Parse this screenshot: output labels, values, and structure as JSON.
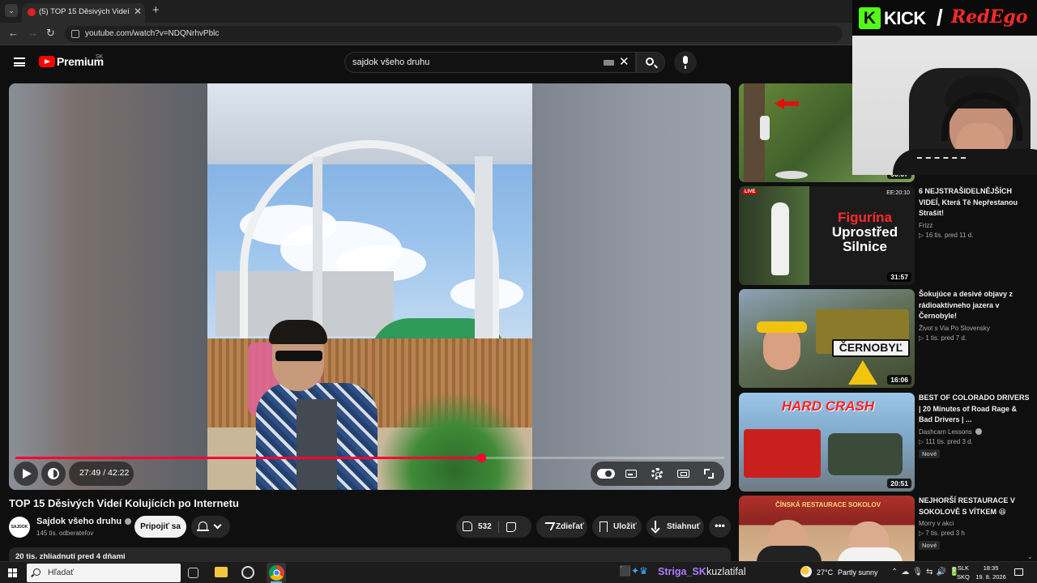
{
  "browser": {
    "tab_title": "(5) TOP 15 Děsivých Videí Koluj",
    "new_tab": "+",
    "url": "youtube.com/watch?v=NDQNrhvPblc"
  },
  "youtube": {
    "brand": "Premium",
    "country": "SK",
    "search_value": "sajdok všeho druhu"
  },
  "player": {
    "time": "27:49 / 42:22",
    "progress_fraction": 0.657
  },
  "video": {
    "title": "TOP 15 Děsivých Videí Kolujících po Internetu",
    "channel": "Sajdok všeho druhu",
    "channel_avatar_text": "SAJDOK",
    "subscribers": "145 tis. odberateľov",
    "join_label": "Pripojiť sa",
    "likes": "532",
    "share_label": "Zdieľať",
    "save_label": "Uložiť",
    "download_label": "Stiahnuť",
    "more_label": "•••",
    "description": "20 tis. zhliadnutí  pred 4 dňami"
  },
  "recommendations": [
    {
      "duration": "30:07",
      "title": "",
      "channel": "",
      "meta": "",
      "badge": ""
    },
    {
      "duration": "31:57",
      "thumb_text": "Figurína\nUprostřed\nSilnice",
      "live": "LIVE",
      "corner": "EE:20:10",
      "title": "6 NEJSTRAŠIDELNĚJŠÍCH VIDEÍ, Která Tě Nepřestanou Strašit!",
      "channel": "Frizz",
      "meta": "▷ 16 tis.  pred 11 d.",
      "badge": ""
    },
    {
      "duration": "16:06",
      "thumb_text": "ČERNOBYĽ",
      "title": "Šokujúce a desivé objavy z rádioaktívneho jazera v Černobyle!",
      "channel": "Život s Via Po Slovensky",
      "meta": "▷ 1 tis.  pred 7 d.",
      "badge": ""
    },
    {
      "duration": "20:51",
      "thumb_text": "HARD CRASH",
      "title": "BEST OF COLORADO DRIVERS |  20 Minutes of Road Rage & Bad Drivers | ...",
      "channel": "Dashcam Lessons",
      "meta": "▷ 111 tis.  pred 3 d.",
      "badge": "Nové"
    },
    {
      "duration": "",
      "thumb_text": "ČÍNSKÁ RESTAURACE SOKOLOV",
      "title": "NEJHORŠÍ RESTAURACE V SOKOLOVĚ S VÍTKEM 😆",
      "channel": "Morry v akci",
      "meta": "▷ 7 tis.  pred 3 h",
      "badge": "Nové"
    }
  ],
  "overlay": {
    "kick_letter": "K",
    "kick": "KICK",
    "slash": "/",
    "streamer": "RedEgo"
  },
  "taskbar": {
    "search_placeholder": "Hľadať",
    "chat_user": "Striga_SK",
    "chat_message": "kuzlatifal",
    "temperature": "27°C",
    "weather": "Partly sunny",
    "lang_1": "SLK",
    "lang_2": "SKQ",
    "time": "18:35",
    "date": "19. 8. 2026"
  },
  "colors": {
    "youtube_red": "#ff0000",
    "progress_red": "#ff0033",
    "kick_green": "#53fc18",
    "chat_user": "#b07cff"
  }
}
